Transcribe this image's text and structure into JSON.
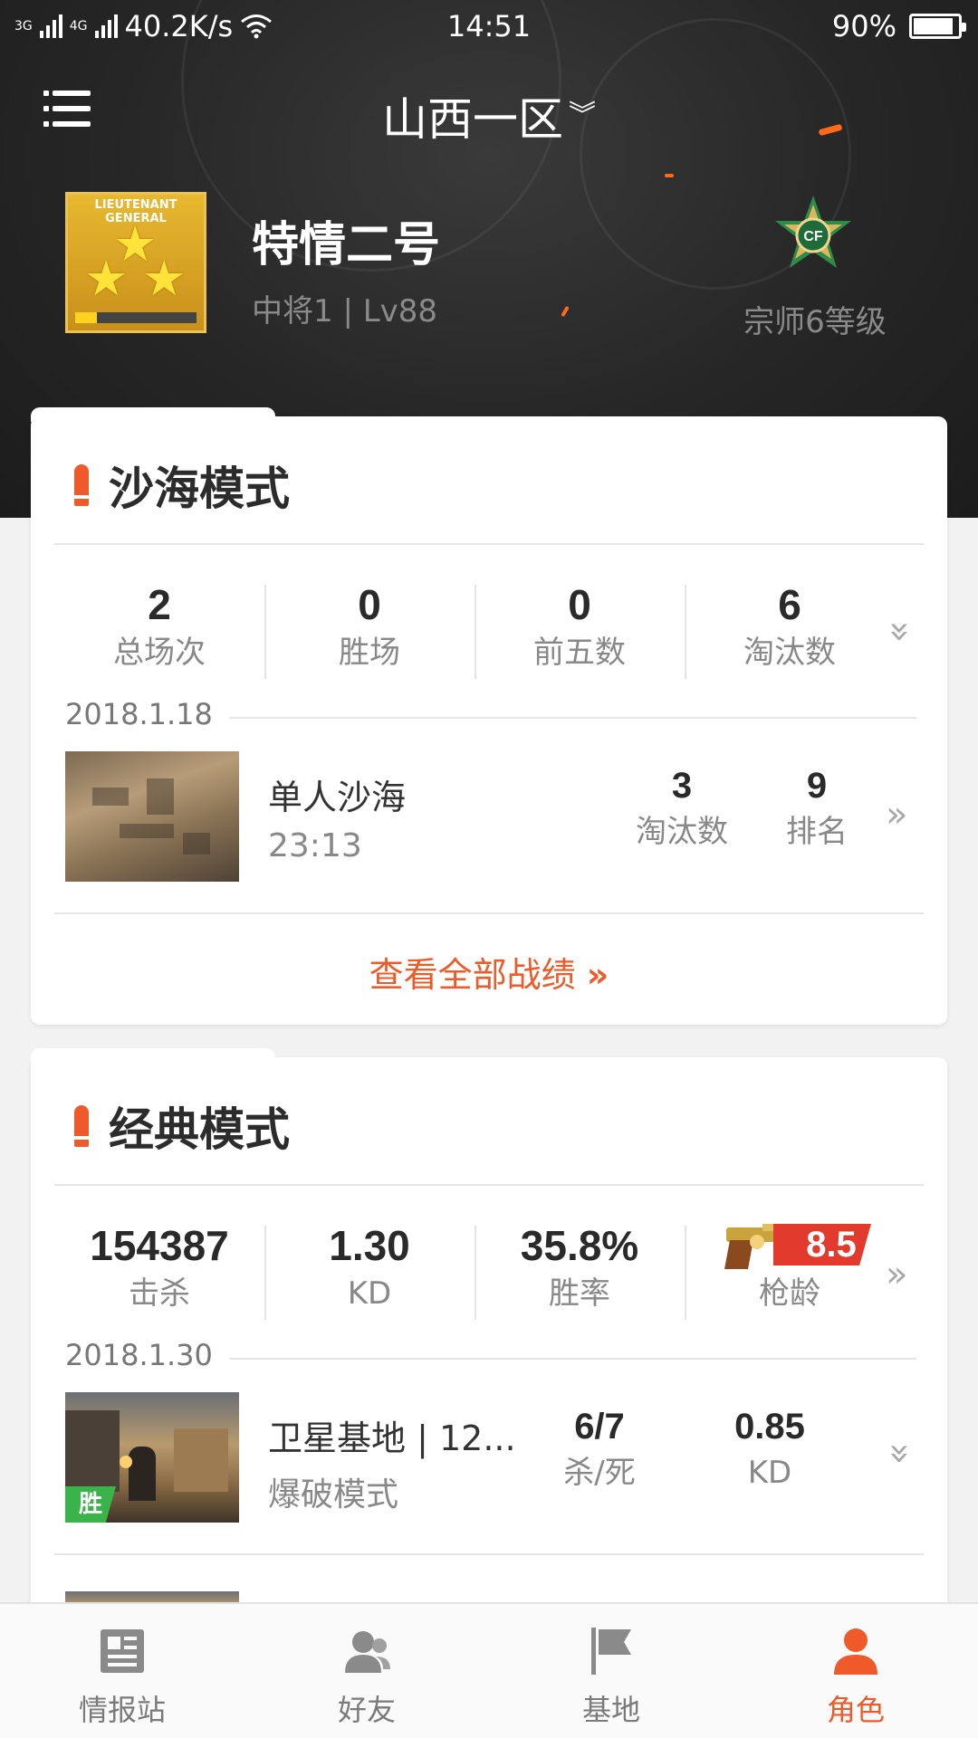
{
  "status_bar": {
    "signal_1": "3G",
    "signal_2": "4G",
    "speed": "40.2K/s",
    "time": "14:51",
    "battery": "90%"
  },
  "header": {
    "region": "山西一区",
    "rank_badge_title": "LIEUTENANT\nGENERAL",
    "player_name": "特情二号",
    "player_level": "中将1 | Lv88",
    "grade": "宗师6等级",
    "emblem_text": "CF"
  },
  "sand_mode": {
    "title": "沙海模式",
    "stats": [
      {
        "value": "2",
        "label": "总场次"
      },
      {
        "value": "0",
        "label": "胜场"
      },
      {
        "value": "0",
        "label": "前五数"
      },
      {
        "value": "6",
        "label": "淘汰数"
      }
    ],
    "date": "2018.1.18",
    "match": {
      "name": "单人沙海",
      "duration": "23:13",
      "stats": [
        {
          "value": "3",
          "label": "淘汰数"
        },
        {
          "value": "9",
          "label": "排名"
        }
      ]
    },
    "view_all": "查看全部战绩"
  },
  "classic_mode": {
    "title": "经典模式",
    "stats": [
      {
        "value": "154387",
        "label": "击杀"
      },
      {
        "value": "1.30",
        "label": "KD"
      },
      {
        "value": "35.8%",
        "label": "胜率"
      },
      {
        "value": "8.5",
        "label": "枪龄"
      }
    ],
    "date": "2018.1.30",
    "match": {
      "name": "卫星基地 | 12...",
      "mode": "爆破模式",
      "result": "胜",
      "stats": [
        {
          "value": "6/7",
          "label": "杀/死"
        },
        {
          "value": "0.85",
          "label": "KD"
        }
      ]
    }
  },
  "tabbar": {
    "tabs": [
      {
        "label": "情报站",
        "icon": "news-icon"
      },
      {
        "label": "好友",
        "icon": "friends-icon"
      },
      {
        "label": "基地",
        "icon": "flag-icon"
      },
      {
        "label": "角色",
        "icon": "person-icon"
      }
    ],
    "active": "角色"
  },
  "colors": {
    "accent": "#ef5a2a",
    "win_green": "#3ab44a",
    "header_bg": "#262626"
  }
}
